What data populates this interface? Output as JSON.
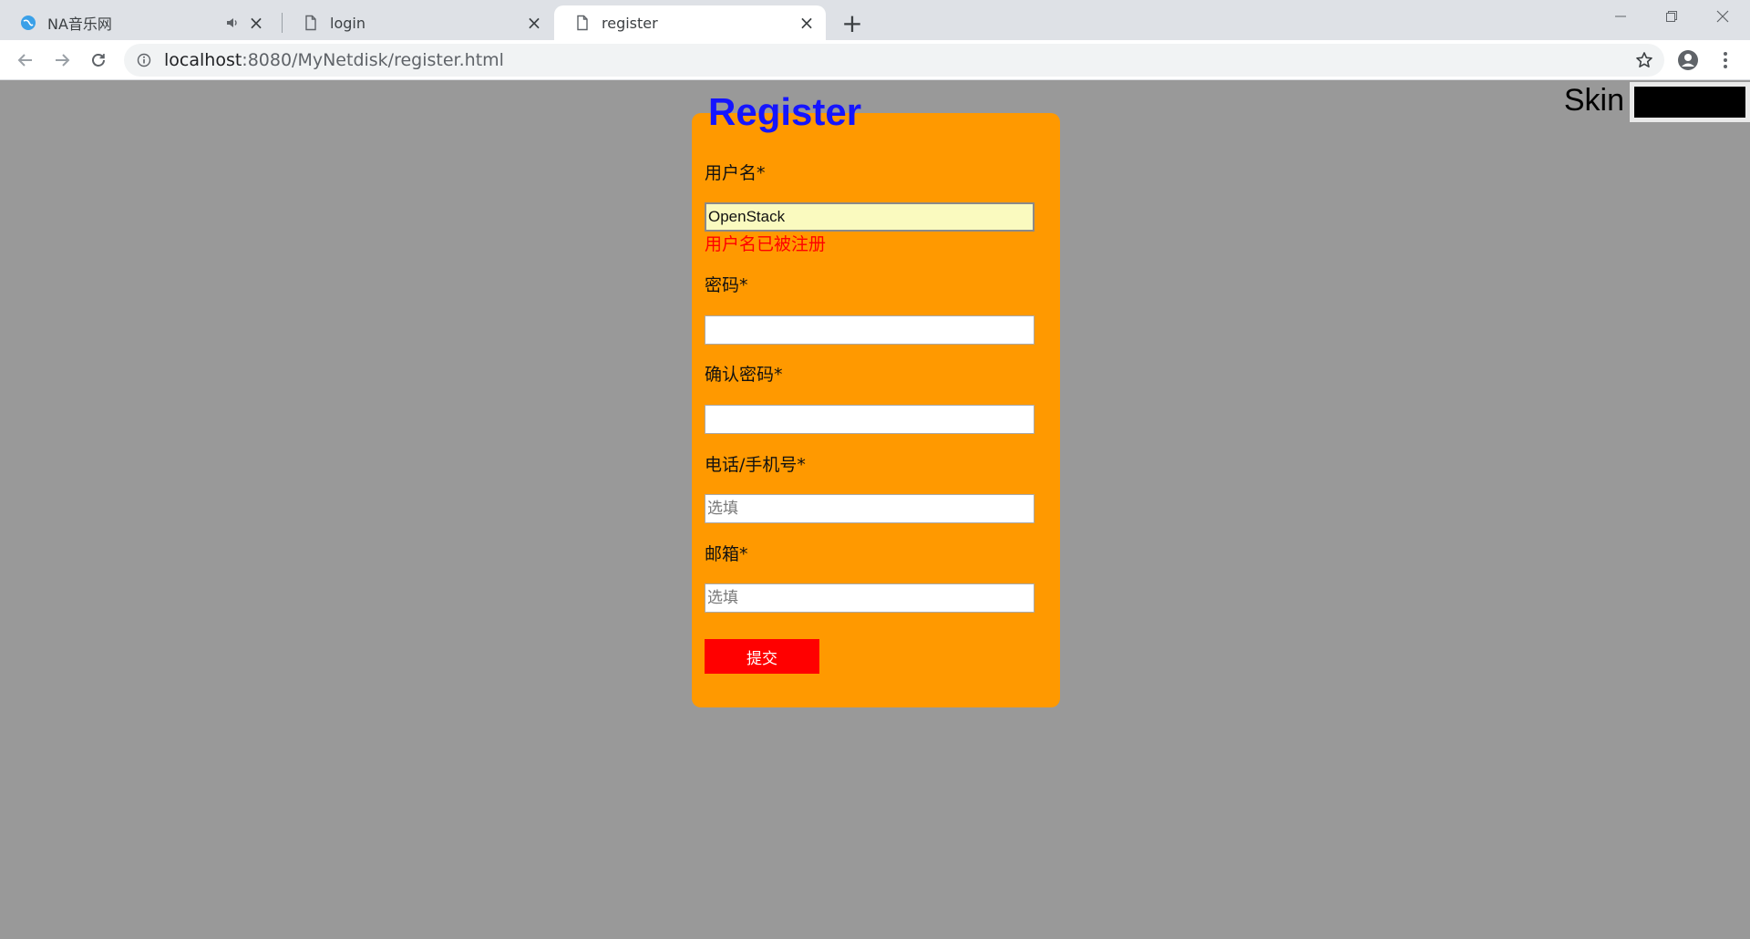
{
  "browser": {
    "tabs": [
      {
        "title": "NA音乐网",
        "state": "inactive",
        "icon": "globe-icon"
      },
      {
        "title": "login",
        "state": "inactive",
        "icon": "page-icon"
      },
      {
        "title": "register",
        "state": "active",
        "icon": "page-icon"
      }
    ],
    "url": {
      "host": "localhost",
      "rest": ":8080/MyNetdisk/register.html"
    }
  },
  "skin": {
    "label": "Skin",
    "selected_color": "#000000"
  },
  "form": {
    "title": "Register",
    "username_label": "用户名*",
    "username_value": "OpenStack",
    "username_error": "用户名已被注册",
    "password_label": "密码*",
    "confirm_label": "确认密码*",
    "phone_label": "电话/手机号*",
    "phone_placeholder": "选填",
    "email_label": "邮箱*",
    "email_placeholder": "选填",
    "submit_label": "提交"
  },
  "colors": {
    "page_bg": "#999999",
    "card_bg": "#ff9900",
    "title": "#1515ff",
    "error": "#ff0000",
    "submit_bg": "#ff0000"
  }
}
